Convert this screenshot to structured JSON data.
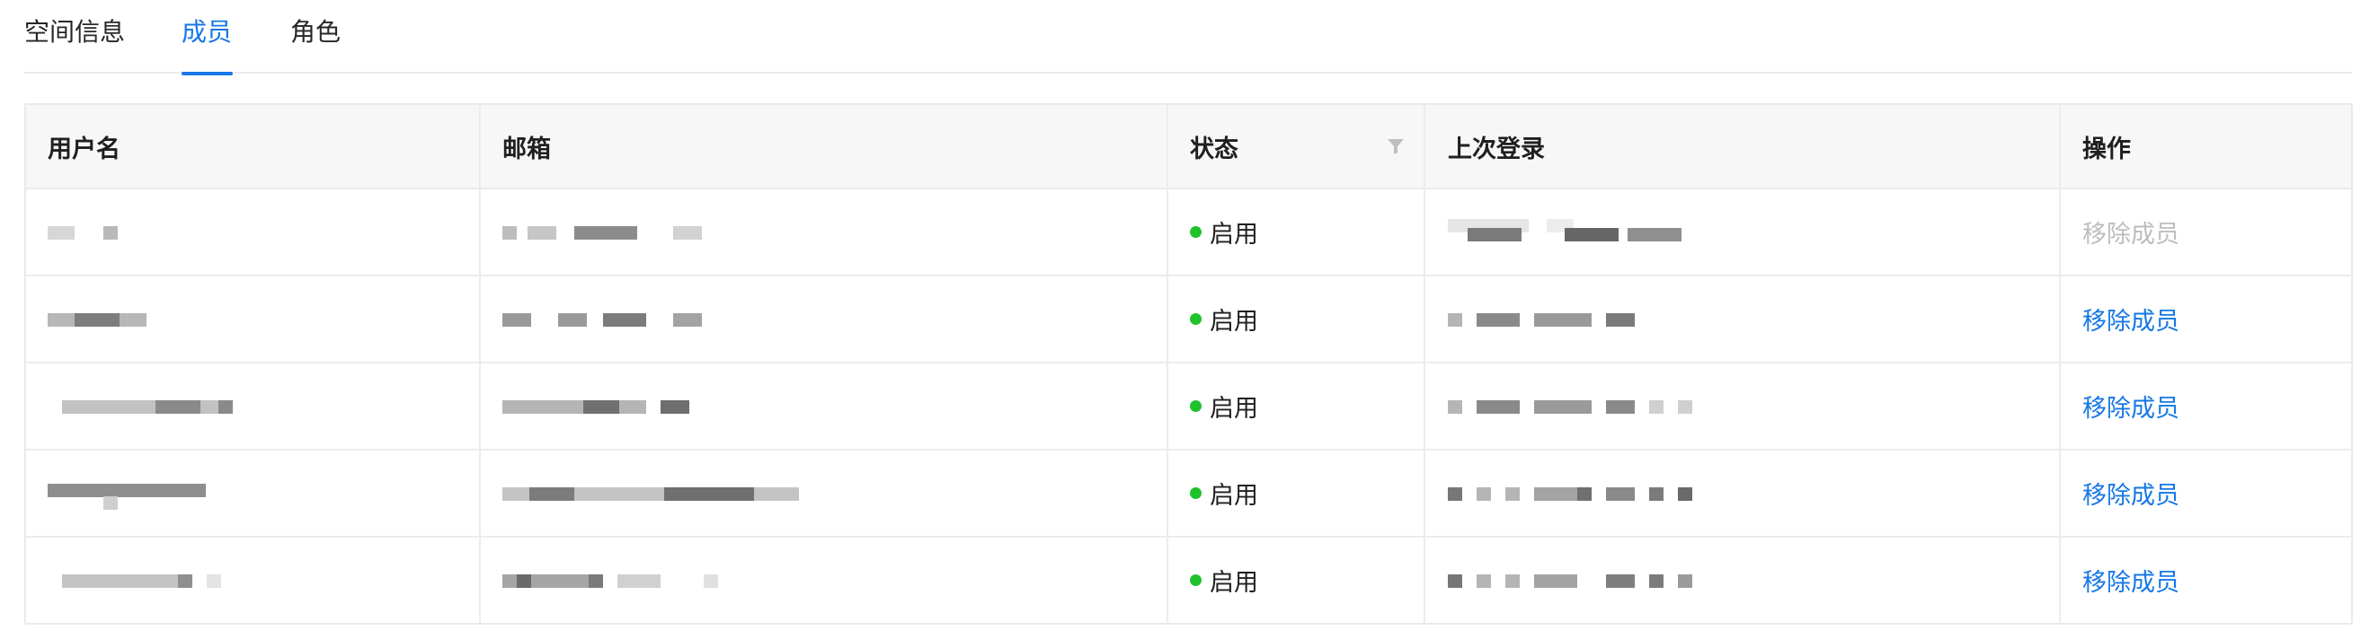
{
  "tabs": [
    {
      "label": "空间信息",
      "active": false
    },
    {
      "label": "成员",
      "active": true
    },
    {
      "label": "角色",
      "active": false
    }
  ],
  "table": {
    "columns": [
      "用户名",
      "邮箱",
      "状态",
      "上次登录",
      "操作"
    ],
    "status_filter_icon": "filter-icon",
    "rows": [
      {
        "status": "启用",
        "action": "移除成员",
        "action_disabled": true
      },
      {
        "status": "启用",
        "action": "移除成员",
        "action_disabled": false
      },
      {
        "status": "启用",
        "action": "移除成员",
        "action_disabled": false
      },
      {
        "status": "启用",
        "action": "移除成员",
        "action_disabled": false
      },
      {
        "status": "启用",
        "action": "移除成员",
        "action_disabled": false
      }
    ]
  },
  "colors": {
    "accent": "#1677e6",
    "status_enabled": "#1fc22d",
    "disabled_text": "#bdbdbd"
  }
}
